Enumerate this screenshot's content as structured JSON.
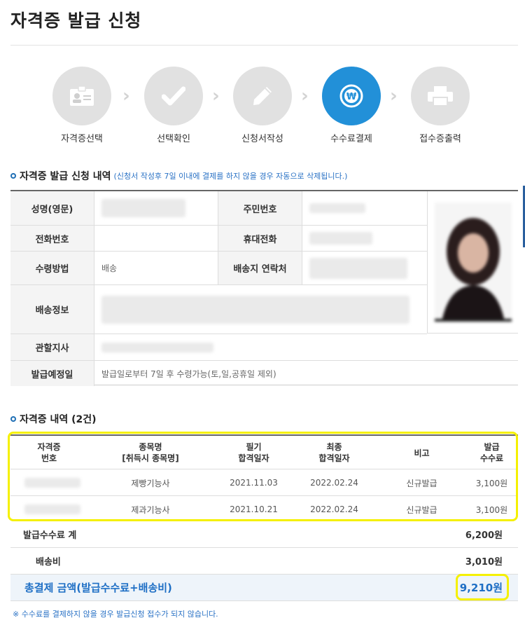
{
  "page": {
    "title": "자격증 발급 신청"
  },
  "steps": [
    {
      "label": "자격증선택",
      "icon": "id-card-icon"
    },
    {
      "label": "선택확인",
      "icon": "check-icon"
    },
    {
      "label": "신청서작성",
      "icon": "pencil-icon"
    },
    {
      "label": "수수료결제",
      "icon": "won-icon",
      "active": true
    },
    {
      "label": "접수증출력",
      "icon": "printer-icon"
    }
  ],
  "application": {
    "heading": "자격증 발급 신청 내역",
    "note": "(신청서 작성후 7일 이내에 결제를 하지 않을 경우 자동으로 삭제됩니다.)",
    "labels": {
      "name": "성명(영문)",
      "resident_no": "주민번호",
      "phone": "전화번호",
      "mobile": "휴대전화",
      "receive_method": "수령방법",
      "delivery_contact": "배송지 연락처",
      "delivery_info": "배송정보",
      "branch": "관할지사",
      "issue_date": "발급예정일"
    },
    "values": {
      "receive_method": "배송",
      "issue_date": "발급일로부터 7일 후 수령가능(토,일,공휴일 제외)"
    }
  },
  "certificates": {
    "heading": "자격증 내역 (2건)",
    "columns": [
      "자격증\n번호",
      "종목명\n[취득시 종목명]",
      "필기\n합격일자",
      "최종\n합격일자",
      "비고",
      "발급\n수수료"
    ],
    "rows": [
      {
        "name": "제빵기능사",
        "written_date": "2021.11.03",
        "final_date": "2022.02.24",
        "note": "신규발급",
        "fee": "3,100원"
      },
      {
        "name": "제과기능사",
        "written_date": "2021.10.21",
        "final_date": "2022.02.24",
        "note": "신규발급",
        "fee": "3,100원"
      }
    ]
  },
  "summary": {
    "fee_total_label": "발급수수료 계",
    "fee_total": "6,200원",
    "shipping_label": "배송비",
    "shipping": "3,010원",
    "grand_total_label": "총결제 금액(발급수수료+배송비)",
    "grand_total": "9,210원"
  },
  "footnote": "※ 수수료를 결제하지 않을 경우 발급신청 접수가 되지 않습니다.",
  "colors": {
    "accent": "#2290d8",
    "highlight": "#f5f000",
    "link": "#2a72c5"
  }
}
